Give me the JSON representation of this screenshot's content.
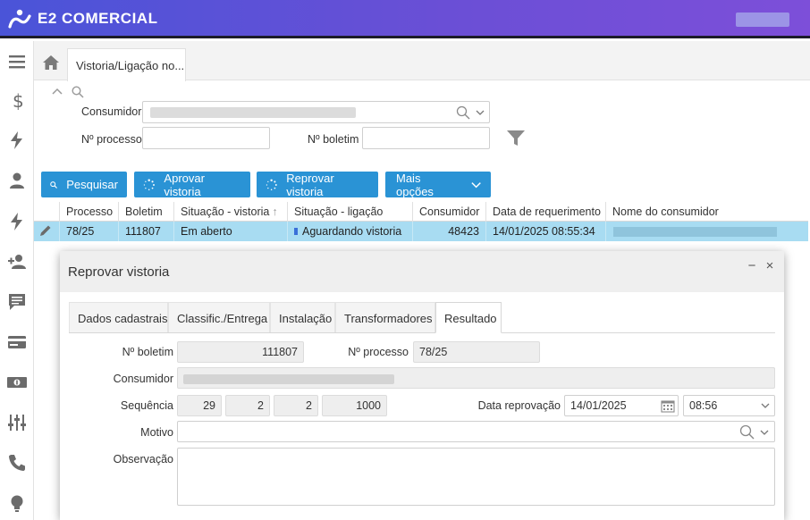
{
  "app": {
    "title": "E2 COMERCIAL"
  },
  "tabs": {
    "active_label": "Vistoria/Ligação no..."
  },
  "filters": {
    "consumidor_label": "Consumidor",
    "processo_label": "Nº processo",
    "boletim_label": "Nº boletim"
  },
  "toolbar": {
    "pesquisar": "Pesquisar",
    "aprovar": "Aprovar vistoria",
    "reprovar": "Reprovar vistoria",
    "mais_opcoes": "Mais opções"
  },
  "grid": {
    "headers": [
      "Processo",
      "Boletim",
      "Situação - vistoria",
      "Situação - ligação",
      "Consumidor",
      "Data de requerimento",
      "Nome do consumidor"
    ],
    "rows": [
      {
        "processo": "78/25",
        "boletim": "111807",
        "situacao_vistoria": "Em aberto",
        "situacao_ligacao": "Aguardando vistoria",
        "consumidor": "48423",
        "data_requerimento": "14/01/2025 08:55:34"
      }
    ]
  },
  "modal": {
    "title": "Reprovar vistoria",
    "minimize": "−",
    "close": "×",
    "tabs": [
      "Dados cadastrais",
      "Classific./Entrega",
      "Instalação",
      "Transformadores",
      "Resultado"
    ],
    "form": {
      "boletim_label": "Nº boletim",
      "boletim_value": "111807",
      "processo_label": "Nº processo",
      "processo_value": "78/25",
      "consumidor_label": "Consumidor",
      "sequencia_label": "Sequência",
      "seq_values": [
        "29",
        "2",
        "2",
        "1000"
      ],
      "data_reprovacao_label": "Data reprovação",
      "data_value": "14/01/2025",
      "hora_value": "08:56",
      "motivo_label": "Motivo",
      "observacao_label": "Observação"
    }
  },
  "icons": [
    "menu-icon",
    "dollar-icon",
    "bolt-icon",
    "user-icon",
    "bolt-icon",
    "user-add-icon",
    "comment-icon",
    "card-icon",
    "money-icon",
    "sliders-icon",
    "phone-icon",
    "bulb-icon"
  ],
  "colors": {
    "header_start": "#4a54d8",
    "header_end": "#7d4fd9",
    "button": "#2a93d5",
    "selected_row": "#a8dcf2"
  }
}
